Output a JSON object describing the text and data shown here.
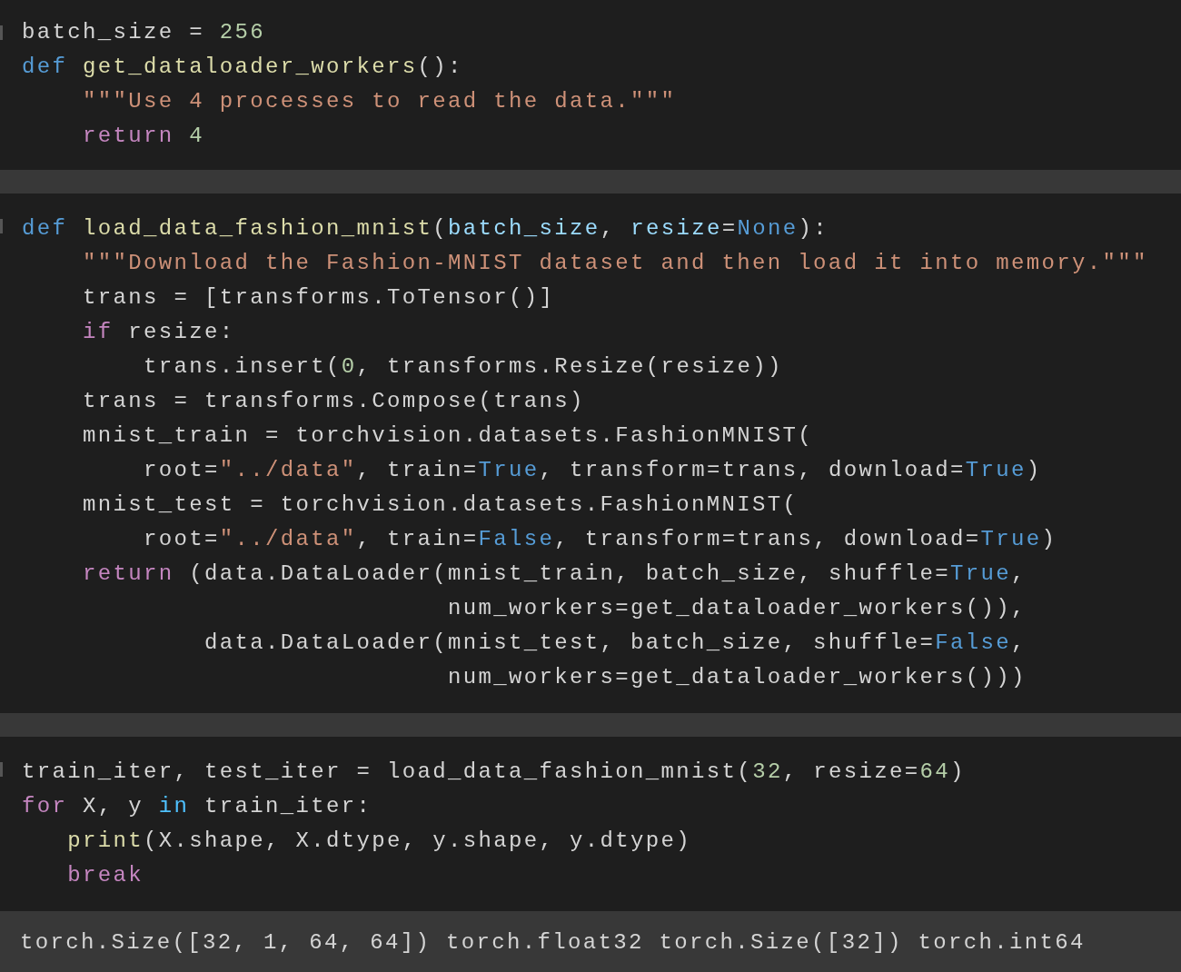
{
  "cells": [
    {
      "lines": [
        [
          {
            "kind": "plain",
            "text": "batch_size = "
          },
          {
            "kind": "num",
            "text": "256"
          }
        ],
        [
          {
            "kind": "kw",
            "text": "def"
          },
          {
            "kind": "fn",
            "text": " get_dataloader_workers"
          },
          {
            "kind": "plain",
            "text": "():"
          }
        ],
        [
          {
            "kind": "str",
            "text": "    \"\"\"Use 4 processes to read the data.\"\"\""
          }
        ],
        [
          {
            "kind": "ctl",
            "text": "    return"
          },
          {
            "kind": "num",
            "text": " 4"
          }
        ]
      ]
    },
    {
      "lines": [
        [
          {
            "kind": "kw",
            "text": "def"
          },
          {
            "kind": "fn",
            "text": " load_data_fashion_mnist"
          },
          {
            "kind": "plain",
            "text": "("
          },
          {
            "kind": "param",
            "text": "batch_size"
          },
          {
            "kind": "plain",
            "text": ", "
          },
          {
            "kind": "param",
            "text": "resize"
          },
          {
            "kind": "plain",
            "text": "="
          },
          {
            "kind": "const",
            "text": "None"
          },
          {
            "kind": "plain",
            "text": "):"
          }
        ],
        [
          {
            "kind": "str",
            "text": "    \"\"\"Download the Fashion-MNIST dataset and then load it into memory.\"\"\""
          }
        ],
        [
          {
            "kind": "plain",
            "text": "    trans = [transforms.ToTensor()]"
          }
        ],
        [
          {
            "kind": "ctl",
            "text": "    if"
          },
          {
            "kind": "plain",
            "text": " resize:"
          }
        ],
        [
          {
            "kind": "plain",
            "text": "        trans.insert("
          },
          {
            "kind": "num",
            "text": "0"
          },
          {
            "kind": "plain",
            "text": ", transforms.Resize(resize))"
          }
        ],
        [
          {
            "kind": "plain",
            "text": "    trans = transforms.Compose(trans)"
          }
        ],
        [
          {
            "kind": "plain",
            "text": "    mnist_train = torchvision.datasets.FashionMNIST("
          }
        ],
        [
          {
            "kind": "plain",
            "text": "        root="
          },
          {
            "kind": "str",
            "text": "\"../data\""
          },
          {
            "kind": "plain",
            "text": ", train="
          },
          {
            "kind": "const",
            "text": "True"
          },
          {
            "kind": "plain",
            "text": ", transform=trans, download="
          },
          {
            "kind": "const",
            "text": "True"
          },
          {
            "kind": "plain",
            "text": ")"
          }
        ],
        [
          {
            "kind": "plain",
            "text": "    mnist_test = torchvision.datasets.FashionMNIST("
          }
        ],
        [
          {
            "kind": "plain",
            "text": "        root="
          },
          {
            "kind": "str",
            "text": "\"../data\""
          },
          {
            "kind": "plain",
            "text": ", train="
          },
          {
            "kind": "const",
            "text": "False"
          },
          {
            "kind": "plain",
            "text": ", transform=trans, download="
          },
          {
            "kind": "const",
            "text": "True"
          },
          {
            "kind": "plain",
            "text": ")"
          }
        ],
        [
          {
            "kind": "ctl",
            "text": "    return"
          },
          {
            "kind": "plain",
            "text": " (data.DataLoader(mnist_train, batch_size, shuffle="
          },
          {
            "kind": "const",
            "text": "True"
          },
          {
            "kind": "plain",
            "text": ","
          }
        ],
        [
          {
            "kind": "plain",
            "text": "                            num_workers=get_dataloader_workers()),"
          }
        ],
        [
          {
            "kind": "plain",
            "text": "            data.DataLoader(mnist_test, batch_size, shuffle="
          },
          {
            "kind": "const",
            "text": "False"
          },
          {
            "kind": "plain",
            "text": ","
          }
        ],
        [
          {
            "kind": "plain",
            "text": "                            num_workers=get_dataloader_workers()))"
          }
        ]
      ]
    },
    {
      "lines": [
        [
          {
            "kind": "plain",
            "text": "train_iter, test_iter = load_data_fashion_mnist("
          },
          {
            "kind": "num",
            "text": "32"
          },
          {
            "kind": "plain",
            "text": ", resize="
          },
          {
            "kind": "num",
            "text": "64"
          },
          {
            "kind": "plain",
            "text": ")"
          }
        ],
        [
          {
            "kind": "ctl",
            "text": "for"
          },
          {
            "kind": "plain",
            "text": " X, y "
          },
          {
            "kind": "op",
            "text": "in"
          },
          {
            "kind": "plain",
            "text": " train_iter:"
          }
        ],
        [
          {
            "kind": "fn",
            "text": "   print"
          },
          {
            "kind": "plain",
            "text": "(X.shape, X.dtype, y.shape, y.dtype)"
          }
        ],
        [
          {
            "kind": "ctl",
            "text": "   break"
          }
        ]
      ],
      "output": "torch.Size([32, 1, 64, 64]) torch.float32 torch.Size([32]) torch.int64"
    }
  ]
}
